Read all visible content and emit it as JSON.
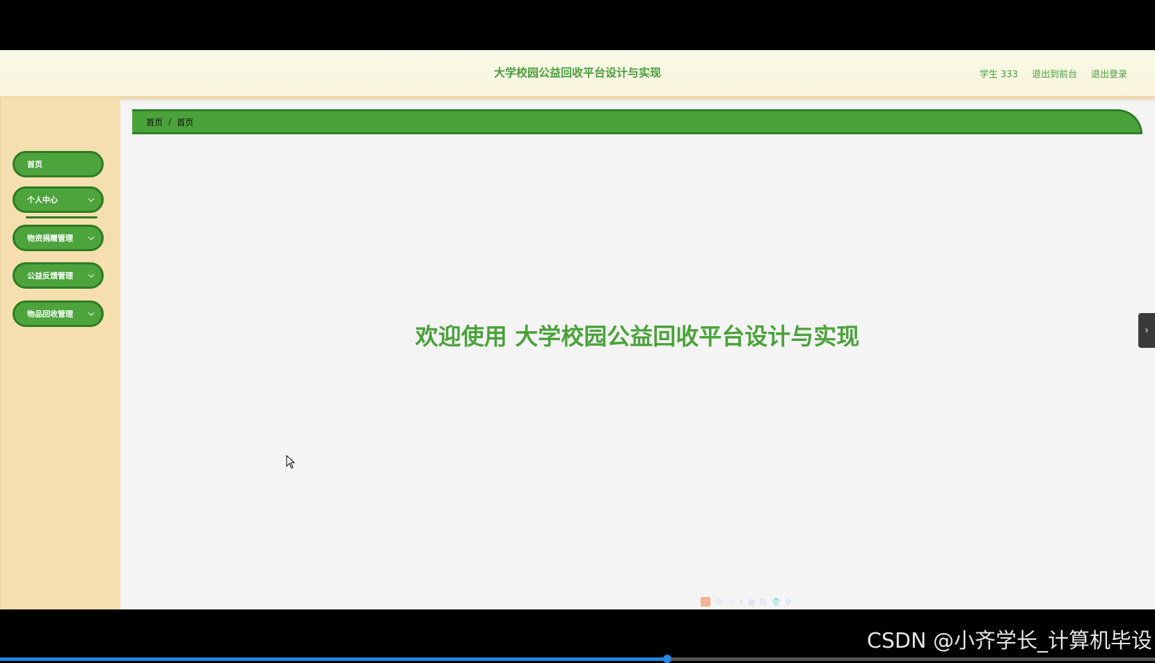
{
  "header": {
    "title": "大学校园公益回收平台设计与实现",
    "user": "学生 333",
    "exit_front": "退出到前台",
    "logout": "退出登录"
  },
  "sidebar": {
    "items": [
      {
        "label": "首页"
      },
      {
        "label": "个人中心"
      },
      {
        "label": "物资捐赠管理"
      },
      {
        "label": "公益反馈管理"
      },
      {
        "label": "物品回收管理"
      }
    ]
  },
  "breadcrumb": {
    "root": "首页",
    "separator": "/",
    "current": "首页"
  },
  "main": {
    "welcome": "欢迎使用 大学校园公益回收平台设计与实现",
    "toggle_glyph": "›"
  },
  "ime": {
    "glyphs": [
      "中",
      "☽",
      "⚬",
      "▦",
      "简",
      "👕",
      "⚙"
    ]
  },
  "watermark": "CSDN @小齐学长_计算机毕设",
  "video": {
    "progress": 0.578
  },
  "colors": {
    "accent": "#4aa23a",
    "accent_dark": "#2d7a22",
    "sidebar_bg": "#f5dfaf"
  }
}
